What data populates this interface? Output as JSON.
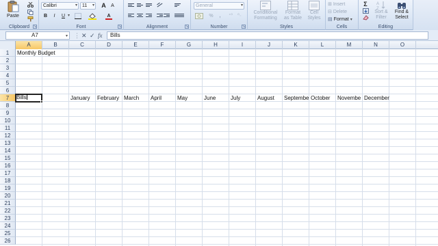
{
  "ribbon": {
    "clipboard": {
      "paste_label": "Paste",
      "group_label": "Clipboard",
      "icons": [
        "cut-icon",
        "copy-icon",
        "format-painter-icon"
      ]
    },
    "font": {
      "font_name": "Calibri",
      "font_size": "11",
      "bold_label": "B",
      "italic_label": "I",
      "underline_label": "U",
      "grow_label": "A",
      "shrink_label": "A",
      "font_color_label": "A",
      "group_label": "Font"
    },
    "alignment": {
      "group_label": "Alignment"
    },
    "number": {
      "format": "General",
      "percent_label": "%",
      "comma_label": ",",
      "group_label": "Number"
    },
    "styles": {
      "conditional_formatting": [
        "Conditional",
        "Formatting"
      ],
      "format_as_table": [
        "Format",
        "as Table"
      ],
      "cell_styles": [
        "Cell",
        "Styles"
      ],
      "group_label": "Styles"
    },
    "cells": {
      "insert": "Insert",
      "delete": "Delete",
      "format": "Format",
      "group_label": "Cells"
    },
    "editing": {
      "sigma": "Σ",
      "sort_filter": [
        "Sort &",
        "Filter"
      ],
      "find_select": [
        "Find &",
        "Select"
      ],
      "group_label": "Editing"
    }
  },
  "formula_bar": {
    "name_box": "A7",
    "fx": "fx",
    "content": "Bills"
  },
  "sheet": {
    "columns": [
      "A",
      "B",
      "C",
      "D",
      "E",
      "F",
      "G",
      "H",
      "I",
      "J",
      "K",
      "L",
      "M",
      "N",
      "O"
    ],
    "rows": [
      "1",
      "2",
      "3",
      "4",
      "5",
      "6",
      "7",
      "8",
      "9",
      "10",
      "11",
      "12",
      "13",
      "14",
      "15",
      "16",
      "17",
      "18",
      "19",
      "20",
      "21",
      "22",
      "23",
      "24",
      "25",
      "26"
    ],
    "selected_column": "A",
    "selected_row": "7",
    "a1": "Monthly Budget",
    "a7": "Bills",
    "months": [
      "January",
      "February",
      "March",
      "April",
      "May",
      "June",
      "July",
      "August",
      "Septembe",
      "October",
      "Novembe",
      "December"
    ]
  },
  "colors": {
    "ribbon_bg": "#dce7f5",
    "selected_header": "#f7c766",
    "gridline": "#d6deea"
  }
}
